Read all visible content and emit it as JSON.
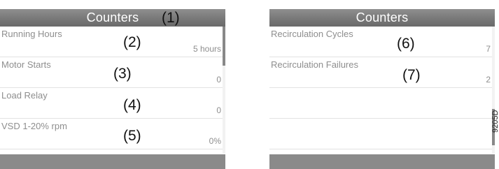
{
  "left_panel": {
    "title": "Counters",
    "rows": [
      {
        "label": "Running Hours",
        "value": "5 hours"
      },
      {
        "label": "Motor Starts",
        "value": "0"
      },
      {
        "label": "Load Relay",
        "value": "0"
      },
      {
        "label": "VSD 1-20% rpm",
        "value": "0%"
      }
    ]
  },
  "right_panel": {
    "title": "Counters",
    "rows": [
      {
        "label": "Recirculation Cycles",
        "value": "7"
      },
      {
        "label": "Recirculation Failures",
        "value": "2"
      },
      {
        "label": "",
        "value": ""
      },
      {
        "label": "",
        "value": ""
      }
    ]
  },
  "callouts": [
    "(1)",
    "(2)",
    "(3)",
    "(4)",
    "(5)",
    "(6)",
    "(7)"
  ],
  "figure_code": "9205D",
  "colors": {
    "title_bar": "#7a7a7a",
    "footer_bar": "#8a8a8a",
    "label_text": "#8e8e8e"
  }
}
